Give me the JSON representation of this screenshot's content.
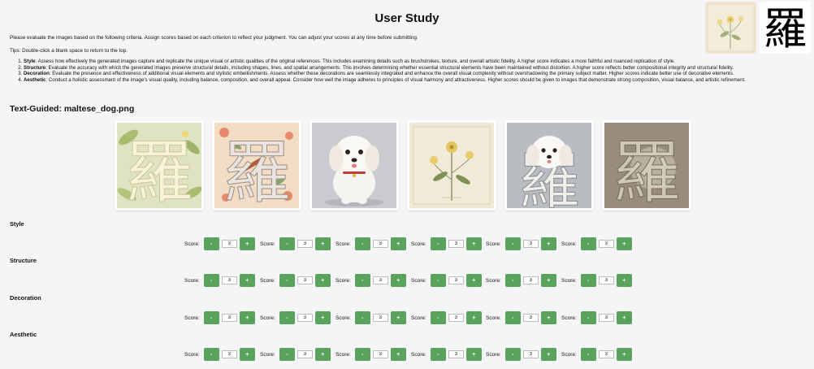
{
  "title": "User Study",
  "intro": "Please evaluate the images based on the following criteria. Assign scores based on each criterion to reflect your judgment. You can adjust your scores at any time before submitting.",
  "tips": "Tips: Double-click a blank space to return to the top.",
  "criteria": [
    {
      "name": "Style",
      "desc": ": Assess how effectively the generated images capture and replicate the unique visual or artistic qualities of the original references. This includes examining details such as brushstrokes, texture, and overall artistic fidelity. A higher score indicates a more faithful and nuanced replication of style."
    },
    {
      "name": "Structure",
      "desc": ": Evaluate the accuracy with which the generated images preserve structural details, including shapes, lines, and spatial arrangements. This involves determining whether essential structural elements have been maintained without distortion. A higher score reflects better compositional integrity and structural fidelity."
    },
    {
      "name": "Decoration",
      "desc": ": Evaluate the presence and effectiveness of additional visual elements and stylistic embellishments. Assess whether these decorations are seamlessly integrated and enhance the overall visual complexity without overshadowing the primary subject matter. Higher scores indicate better use of decorative elements."
    },
    {
      "name": "Aesthetic",
      "desc": ": Conduct a holistic assessment of the image's visual quality, including balance, composition, and overall appeal. Consider how well the image adheres to principles of visual harmony and attractiveness. Higher scores should be given to images that demonstrate strong composition, visual balance, and artistic refinement."
    }
  ],
  "ref_char": "羅",
  "section_title": "Text-Guided: maltese_dog.png",
  "gallery_char": "羅",
  "score_label": "Score:",
  "minus_label": "-",
  "plus_label": "+",
  "scores": {
    "style": [
      "3",
      "3",
      "3",
      "3",
      "3",
      "3"
    ],
    "structure": [
      "3",
      "3",
      "3",
      "3",
      "3",
      "3"
    ],
    "decoration": [
      "3",
      "3",
      "3",
      "3",
      "3",
      "3"
    ],
    "aesthetic": [
      "3",
      "3",
      "3",
      "3",
      "3",
      "3"
    ]
  },
  "colors": {
    "button_green": "#5aa35d",
    "background": "#f5f5f7"
  }
}
